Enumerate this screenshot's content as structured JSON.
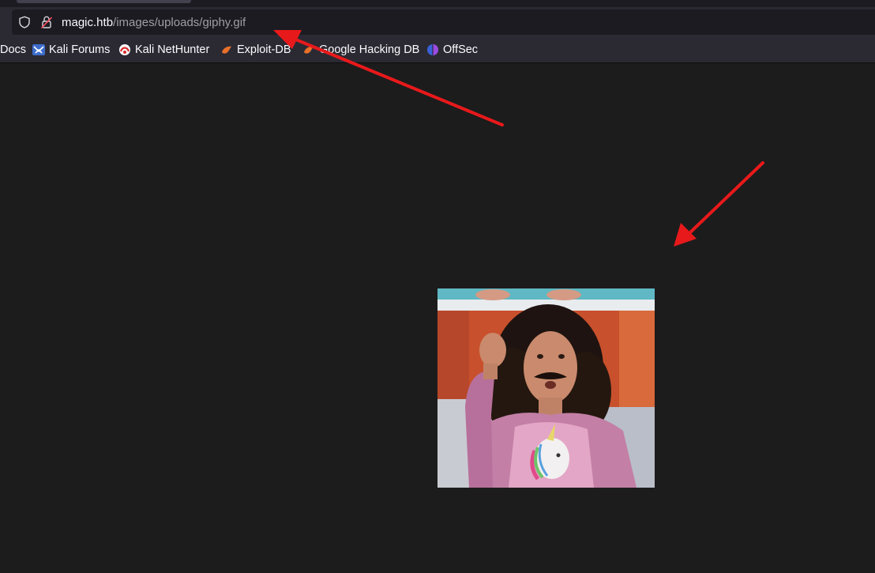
{
  "url": {
    "host": "magic.htb",
    "path": "/images/uploads/giphy.gif"
  },
  "bookmarks": [
    {
      "label": "Docs",
      "icon": "docs-icon"
    },
    {
      "label": "Kali Forums",
      "icon": "kali-forums-icon"
    },
    {
      "label": "Kali NetHunter",
      "icon": "kali-nethunter-icon"
    },
    {
      "label": "Exploit-DB",
      "icon": "exploit-db-icon"
    },
    {
      "label": "Google Hacking DB",
      "icon": "google-hacking-db-icon"
    },
    {
      "label": "OffSec",
      "icon": "offsec-icon"
    }
  ],
  "colors": {
    "annotation_arrow": "#e8191b",
    "page_background": "#1c1c1c",
    "toolbar": "#2b2a33"
  },
  "image": {
    "subject": "giphy-gif-man-with-curly-hair-and-unicorn-shirt"
  }
}
